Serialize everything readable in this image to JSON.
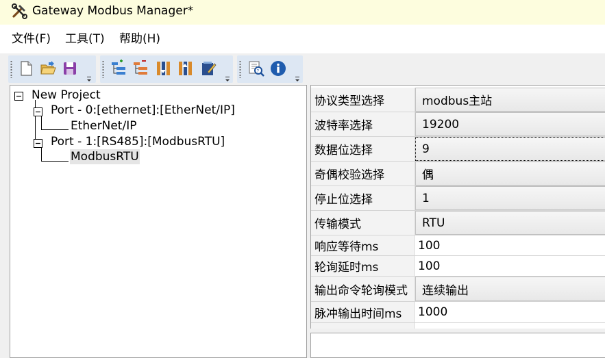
{
  "window": {
    "title": "Gateway Modbus Manager*",
    "app_icon": "tools-hammer-wrench-icon"
  },
  "menu": {
    "items": [
      {
        "label": "文件(F)",
        "accel": "F"
      },
      {
        "label": "工具(T)",
        "accel": "T"
      },
      {
        "label": "帮助(H)",
        "accel": "H"
      }
    ]
  },
  "toolbar": {
    "groups": [
      {
        "buttons": [
          "new-file-icon",
          "open-folder-icon",
          "save-disk-icon"
        ]
      },
      {
        "buttons": [
          "add-port-icon",
          "remove-port-icon",
          "read-config-icon",
          "write-config-icon",
          "edit-notepad-icon"
        ]
      },
      {
        "buttons": [
          "help-search-icon",
          "about-info-icon"
        ]
      }
    ]
  },
  "tree": {
    "root": "New Project",
    "ports": [
      {
        "label": "Port - 0:[ethernet]:[EtherNet/IP]",
        "child": "EtherNet/IP"
      },
      {
        "label": "Port - 1:[RS485]:[ModbusRTU]",
        "child": "ModbusRTU",
        "selected": true
      }
    ]
  },
  "properties": [
    {
      "label": "协议类型选择",
      "value": "modbus主站",
      "kind": "combo"
    },
    {
      "label": "波特率选择",
      "value": "19200",
      "kind": "combo"
    },
    {
      "label": "数据位选择",
      "value": "9",
      "kind": "combo",
      "focused": true
    },
    {
      "label": "奇偶校验选择",
      "value": "偶",
      "kind": "combo"
    },
    {
      "label": "停止位选择",
      "value": "1",
      "kind": "combo"
    },
    {
      "label": "传输模式",
      "value": "RTU",
      "kind": "combo"
    },
    {
      "label": "响应等待ms",
      "value": "100",
      "kind": "edit"
    },
    {
      "label": "轮询延时ms",
      "value": "100",
      "kind": "edit"
    },
    {
      "label": "输出命令轮询模式",
      "value": "连续输出",
      "kind": "combo"
    },
    {
      "label": "脉冲输出时间ms",
      "value": "1000",
      "kind": "edit"
    }
  ],
  "colors": {
    "titlebar": "#fdfdde",
    "toolbar_group": "#dde7f3",
    "selection": "#e5e5e5"
  }
}
